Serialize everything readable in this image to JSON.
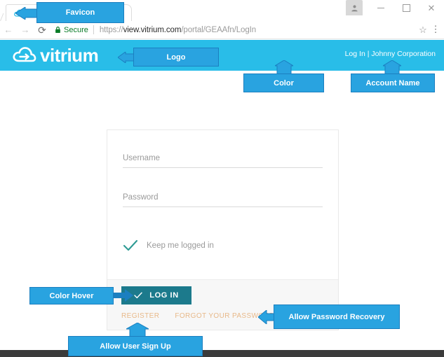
{
  "browser": {
    "tab": {
      "favicon_name": "vitrium-cloud-favicon",
      "title": ""
    },
    "window_controls": {
      "profile": "profile-icon",
      "minimize": "–",
      "maximize": "□",
      "close": "✕"
    },
    "toolbar": {
      "back": "←",
      "forward": "→",
      "reload": "⟳",
      "security_label": "Secure",
      "url_scheme": "https://",
      "url_host": "view.vitrium.com",
      "url_path": "/portal/GEAAfn/LogIn",
      "url_full": "https://view.vitrium.com/portal/GEAAfn/LogIn",
      "bookmark": "☆",
      "menu": "⋮"
    }
  },
  "site_header": {
    "brand_name": "vitrium",
    "account_text": "Log In | Johnny Corporation",
    "background_color": "#29bde8"
  },
  "login_form": {
    "username": {
      "placeholder": "Username",
      "value": ""
    },
    "password": {
      "placeholder": "Password",
      "value": ""
    },
    "remember": {
      "label": "Keep me logged in",
      "checked": true
    },
    "submit_label": "LOG IN",
    "submit_color": "#1c7a8c",
    "links": [
      {
        "label": "REGISTER"
      },
      {
        "label": "FORGOT YOUR PASSWORD?"
      }
    ],
    "link_color": "#e8b98a"
  },
  "annotations": {
    "accent_color": "#29a3e0",
    "items": [
      {
        "label": "Favicon"
      },
      {
        "label": "Logo"
      },
      {
        "label": "Color"
      },
      {
        "label": "Account Name"
      },
      {
        "label": "Color Hover"
      },
      {
        "label": "Allow Password Recovery"
      },
      {
        "label": "Allow User Sign Up"
      }
    ]
  }
}
